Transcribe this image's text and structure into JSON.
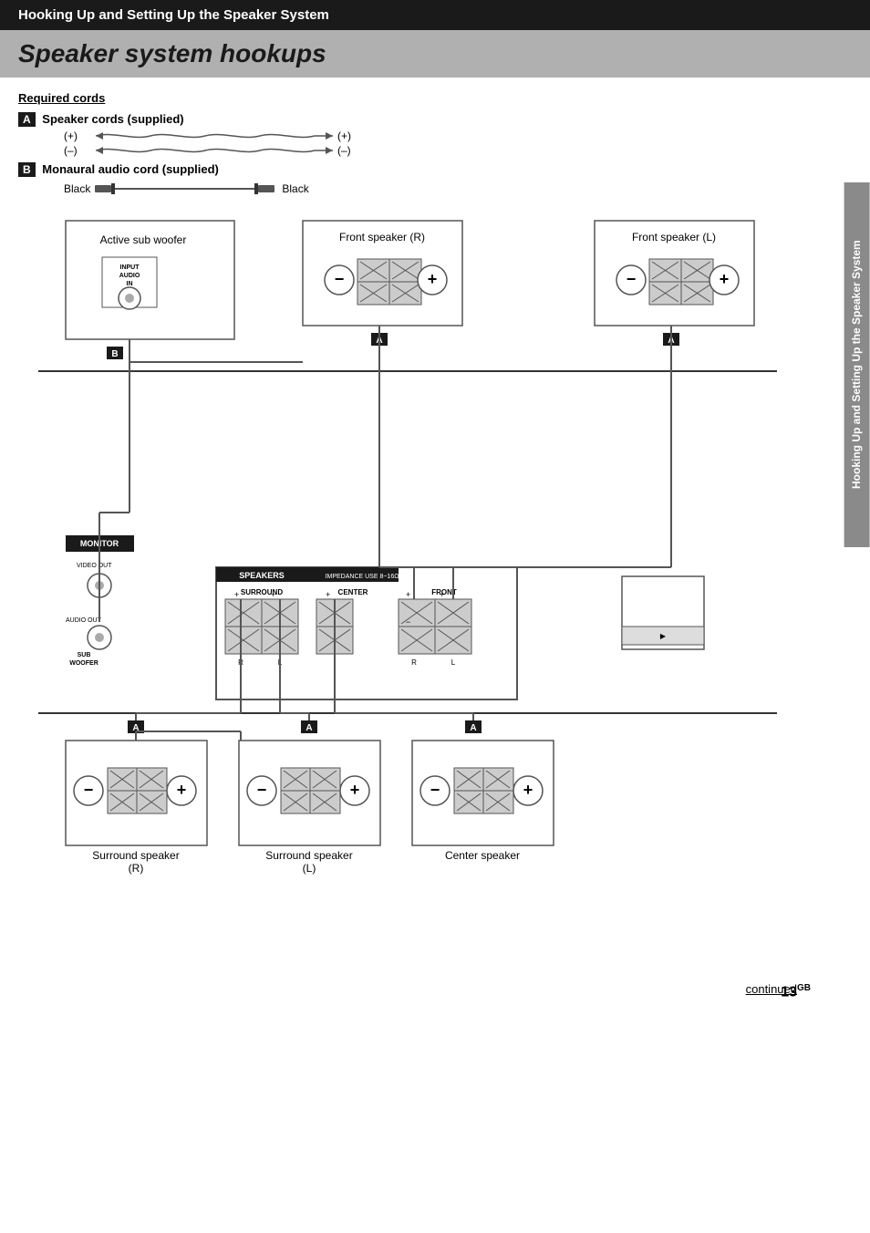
{
  "header": {
    "title": "Hooking Up and Setting Up the Speaker System"
  },
  "page_title": "Speaker system hookups",
  "sections": {
    "required_cords": "Required cords",
    "cord_a_label": "Speaker cords (supplied)",
    "cord_a_badge": "A",
    "cord_b_label": "Monaural audio cord (supplied)",
    "cord_b_badge": "B",
    "cord_plus": "(+)",
    "cord_minus": "(–)",
    "cord_black_left": "Black",
    "cord_black_right": "Black"
  },
  "speakers": {
    "active_sub_woofer": "Active sub woofer",
    "front_speaker_r": "Front speaker (R)",
    "front_speaker_l": "Front speaker (L)",
    "surround_speaker_r": "Surround speaker\n(R)",
    "surround_speaker_l": "Surround speaker\n(L)",
    "center_speaker": "Center speaker"
  },
  "labels": {
    "badge_a": "A",
    "badge_b": "B",
    "badge_monitor": "MONITOR",
    "badge_speakers": "SPEAKERS",
    "impedance": "IMPEDANCE USE 8~16Ω",
    "surround": "SURROUND",
    "center": "CENTER",
    "front": "FRONT",
    "plus": "+",
    "minus": "–",
    "r": "R",
    "l": "L",
    "audio_in": "AUDIO IN",
    "input": "INPUT",
    "video_out": "VIDEO OUT",
    "audio_out": "AUDIO OUT",
    "sub_woofer": "SUB WOOFER"
  },
  "footer": {
    "continued": "continued",
    "page_number": "13",
    "page_suffix": "GB"
  },
  "side_tab": "Hooking Up and Setting Up the Speaker System"
}
